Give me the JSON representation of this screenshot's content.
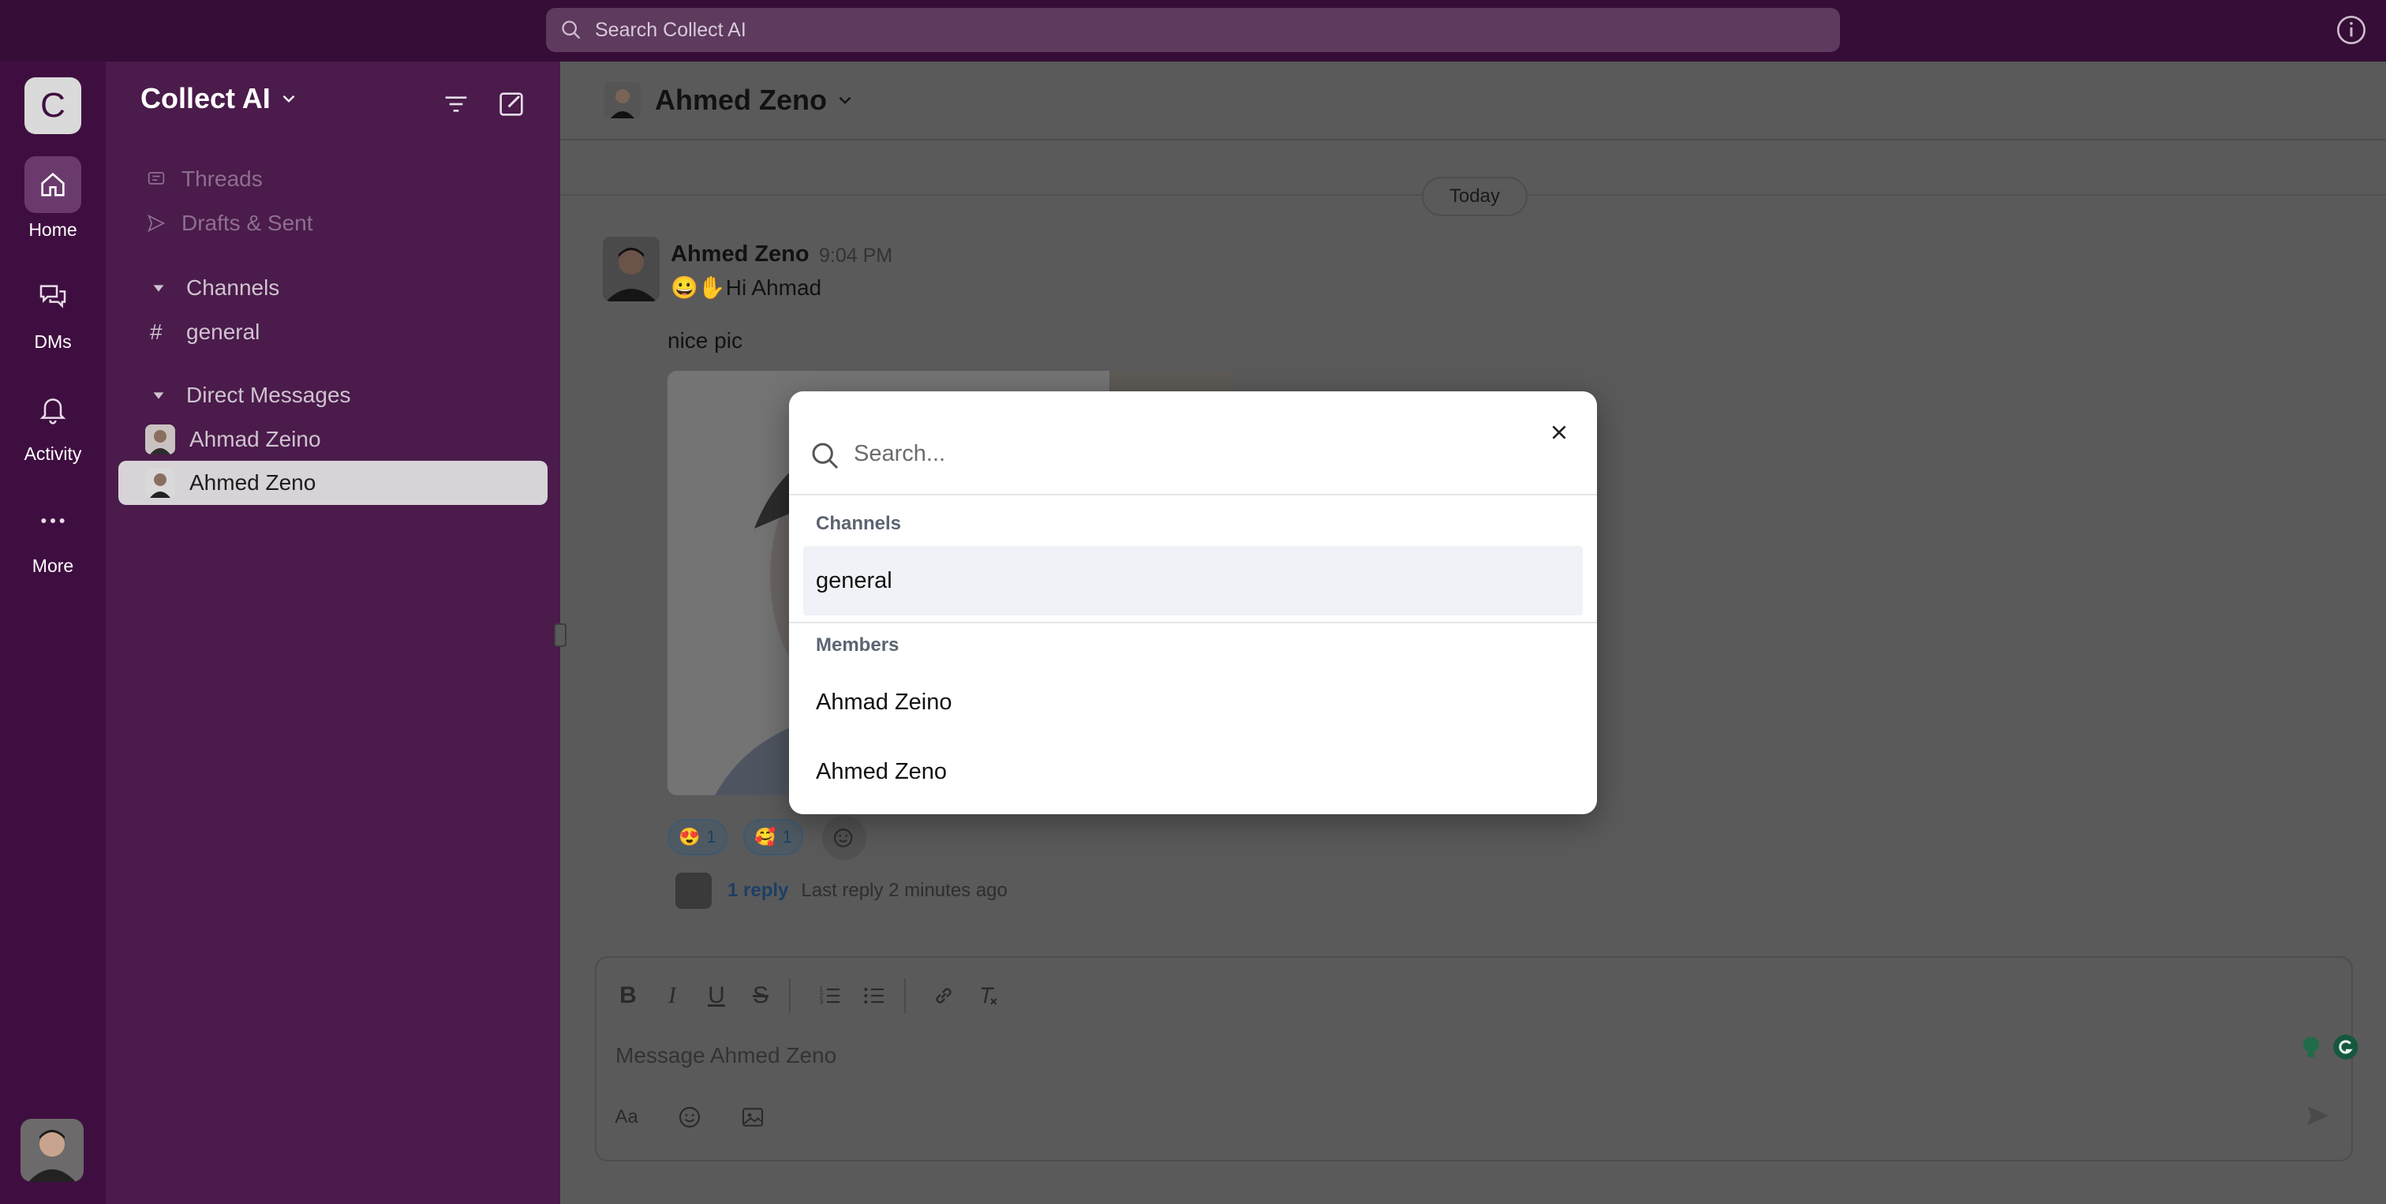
{
  "topbar": {
    "search_placeholder": "Search Collect AI",
    "info_icon": "info-icon"
  },
  "rail": {
    "workspace_initial": "C",
    "items": [
      {
        "label": "Home",
        "icon": "home-icon"
      },
      {
        "label": "DMs",
        "icon": "chat-bubbles-icon"
      },
      {
        "label": "Activity",
        "icon": "bell-icon"
      },
      {
        "label": "More",
        "icon": "more-dots-icon"
      }
    ]
  },
  "sidebar": {
    "workspace_name": "Collect AI",
    "threads_label": "Threads",
    "drafts_label": "Drafts & Sent",
    "channels_header": "Channels",
    "channels": [
      {
        "name": "general"
      }
    ],
    "dm_header": "Direct Messages",
    "dms": [
      {
        "name": "Ahmad Zeino"
      },
      {
        "name": "Ahmed Zeno"
      }
    ]
  },
  "main": {
    "header_name": "Ahmed Zeno",
    "date_divider": "Today",
    "message": {
      "author": "Ahmed Zeno",
      "time": "9:04 PM",
      "text": "😀✋Hi Ahmad",
      "text2": "nice pic"
    },
    "reactions": [
      {
        "emoji": "😍",
        "count": "1"
      },
      {
        "emoji": "🥰",
        "count": "1"
      }
    ],
    "thread": {
      "reply_label": "1 reply",
      "last_reply": "Last reply 2 minutes ago"
    },
    "composer": {
      "placeholder": "Message Ahmed Zeno",
      "aa_label": "Aa"
    }
  },
  "modal": {
    "search_placeholder": "Search...",
    "channels_label": "Channels",
    "channels": [
      "general"
    ],
    "members_label": "Members",
    "members": [
      "Ahmad Zeino",
      "Ahmed Zeno"
    ]
  }
}
